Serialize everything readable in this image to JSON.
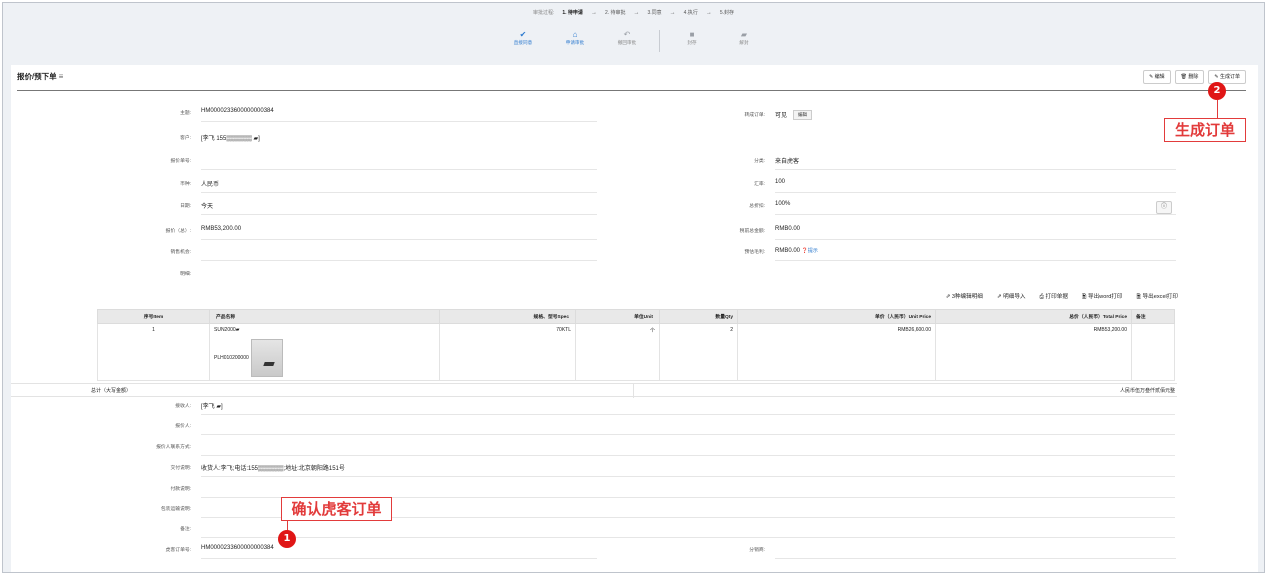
{
  "workflow": {
    "prefix": "审批过程:",
    "steps": [
      "1. 待申请",
      "2. 待审批",
      "3.同意",
      "4.执行",
      "5.封存"
    ],
    "actions": [
      {
        "label": "直接同意",
        "icon": "check-icon"
      },
      {
        "label": "申请审批",
        "icon": "send-icon"
      },
      {
        "label": "撤回审批",
        "icon": "undo-icon"
      },
      {
        "label": "封存",
        "icon": "folder-icon"
      },
      {
        "label": "解封",
        "icon": "folder-open-icon"
      }
    ]
  },
  "page": {
    "title": "报价/预下单",
    "menu_glyph": "≡",
    "buttons": {
      "edit": "✎ 编辑",
      "delete": "🗑 删除",
      "create_order": "✎ 生成订单"
    }
  },
  "form": {
    "subject": {
      "label": "主题:",
      "value": "HM0000233600000000384"
    },
    "customer": {
      "label": "客户:",
      "value": "[李飞 155▒▒▒▒▒▒ ▰]"
    },
    "quote_no": {
      "label": "报价单号:",
      "value": ""
    },
    "currency": {
      "label": "币种:",
      "value": "人民币"
    },
    "date": {
      "label": "日期:",
      "value": "今天"
    },
    "quote_total": {
      "label": "报价（总）:",
      "value": "RMB53,200.00"
    },
    "sales_opportunity": {
      "label": "销售机会:",
      "value": ""
    },
    "details": {
      "label": "明细:",
      "value": ""
    },
    "converted_order": {
      "label": "转成订单:",
      "value": "可见",
      "edit_btn": "编辑"
    },
    "category": {
      "label": "分类:",
      "value": "来自虎客"
    },
    "exchange_rate": {
      "label": "汇率:",
      "value": "100"
    },
    "total_discount": {
      "label": "总折扣:",
      "value": "100%"
    },
    "pretax_total": {
      "label": "税前总金额:",
      "value": "RMB0.00"
    },
    "estimated_margin": {
      "label": "预估毛利:",
      "value": "RMB0.00",
      "hint": "提示"
    }
  },
  "toolbar": {
    "edit_details": "⇗ 3种编辑明细",
    "import_details": "⇗ 明细导入",
    "print_quote": "⎙ 打印单据",
    "export_word": "🖹 导出word打印",
    "export_excel": "🖹 导出excel打印"
  },
  "table": {
    "headers": [
      "序号Item",
      "产品名称",
      "规格、型号Spec",
      "单位Unit",
      "数量Qty",
      "单价（人民币）Unit Price",
      "总价（人民币）Total Price",
      "备注"
    ],
    "rows": [
      {
        "item": "1",
        "product": "SUN2000▰",
        "product_code": "PLH010200000",
        "spec": "70KTL",
        "unit": "个",
        "qty": "2",
        "unit_price": "RMB26,600.00",
        "total_price": "RMB53,200.00",
        "remark": ""
      }
    ],
    "total_label": "总计（大写金额）",
    "total_value": "人民币伍万叁仟贰佰元整"
  },
  "form2": {
    "receiver": {
      "label": "接收人:",
      "value": "[李飞 ▰]"
    },
    "quoter": {
      "label": "报价人:",
      "value": ""
    },
    "quoter_contact": {
      "label": "报价人联系方式:",
      "value": ""
    },
    "delivery": {
      "label": "交付说明:",
      "value": "收货人:李飞;电话:155▒▒▒▒▒▒;地址:北京朝阳路151号"
    },
    "payment": {
      "label": "付款说明:",
      "value": ""
    },
    "packing": {
      "label": "包装运输说明:",
      "value": ""
    },
    "remark": {
      "label": "备注:",
      "value": ""
    },
    "huke_order_no": {
      "label": "虎客订单号:",
      "value": "HM0000233600000000384"
    },
    "distributor": {
      "label": "分销商:",
      "value": ""
    }
  },
  "annotations": {
    "callout1": "确认虎客订单",
    "badge1": "1",
    "callout2": "生成订单",
    "badge2": "2"
  }
}
